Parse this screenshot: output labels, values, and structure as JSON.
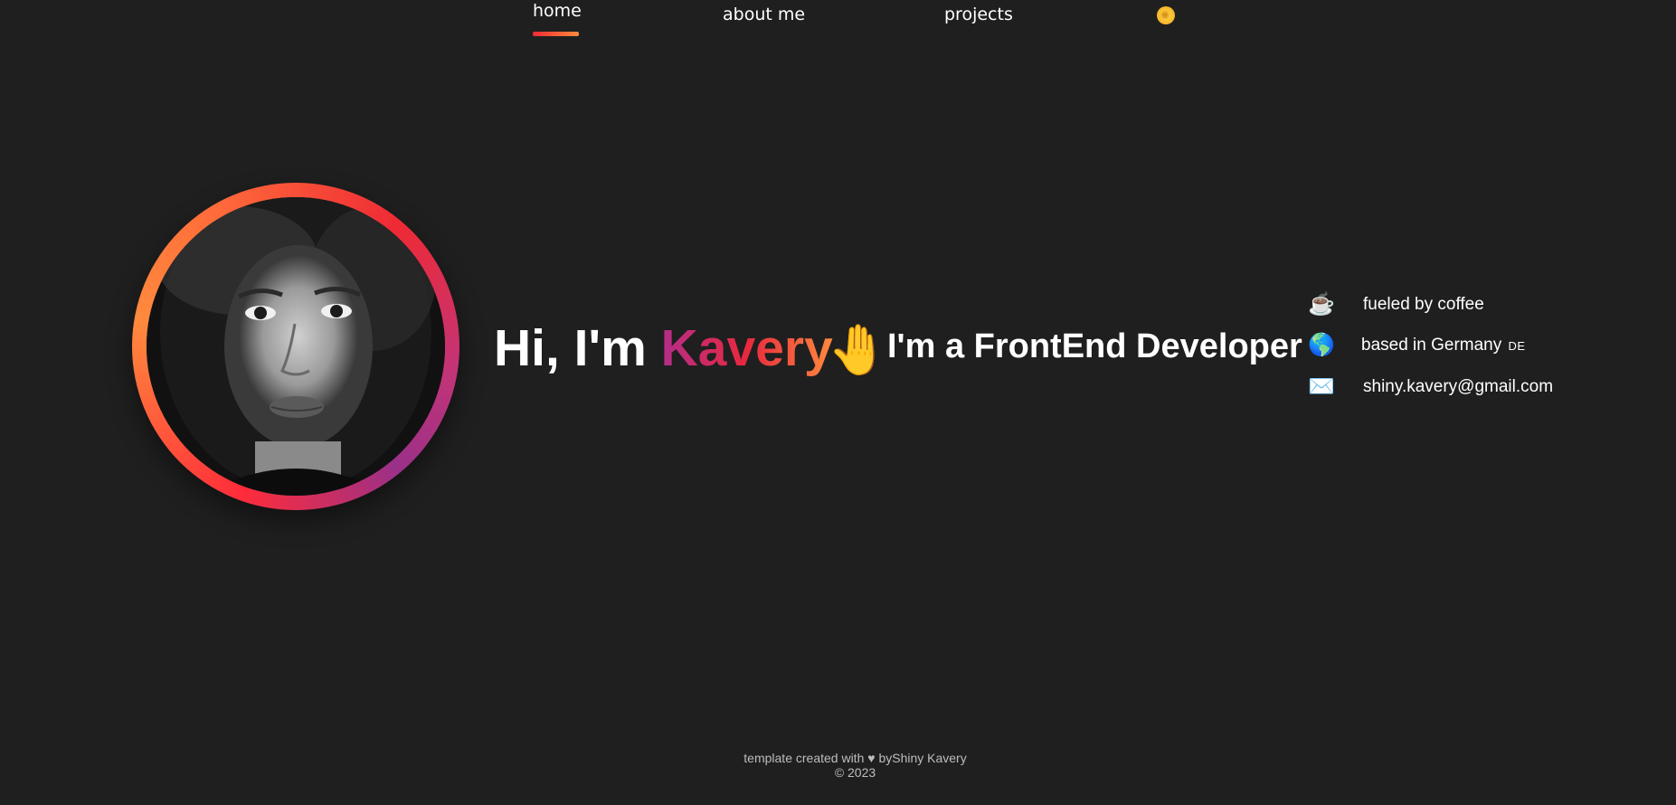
{
  "nav": {
    "items": [
      {
        "label": "home",
        "active": true
      },
      {
        "label": "about me",
        "active": false
      },
      {
        "label": "projects",
        "active": false
      }
    ],
    "theme_toggle_icon": "sun-icon"
  },
  "hero": {
    "greeting": "Hi, I'm ",
    "name": "Kavery",
    "wave_emoji": "🤚",
    "role": "I'm a FrontEnd Developer",
    "avatar_icon": "profile-photo"
  },
  "info": [
    {
      "icon": "☕",
      "icon_name": "coffee-icon",
      "text": "fueled by coffee"
    },
    {
      "icon": "🌎",
      "icon_name": "globe-icon",
      "text": "based in Germany",
      "flag": "DE"
    },
    {
      "icon": "✉️",
      "icon_name": "email-icon",
      "text": "shiny.kavery@gmail.com"
    }
  ],
  "footer": {
    "line1": "template created with ♥ byShiny Kavery",
    "line2": "© 2023"
  },
  "colors": {
    "background": "#1f1f1f",
    "accent_start": "#b42d8a",
    "accent_mid": "#e8283e",
    "accent_end": "#ff8a3d"
  }
}
